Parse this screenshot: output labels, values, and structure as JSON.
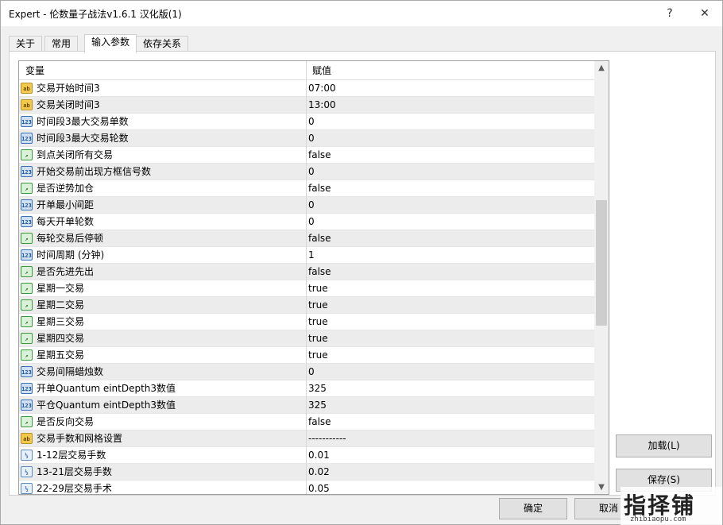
{
  "window": {
    "title": "Expert - 伦数量子战法v1.6.1 汉化版(1)",
    "help_label": "?",
    "close_label": "✕"
  },
  "tabs": [
    {
      "label": "关于",
      "active": false
    },
    {
      "label": "常用",
      "active": false
    },
    {
      "label": "输入参数",
      "active": true
    },
    {
      "label": "依存关系",
      "active": false
    }
  ],
  "grid": {
    "col_variable": "变量",
    "col_value": "赋值",
    "rows": [
      {
        "icon": "ab",
        "name": "交易开始时间3",
        "value": "07:00"
      },
      {
        "icon": "ab",
        "name": "交易关闭时间3",
        "value": "13:00"
      },
      {
        "icon": "num",
        "name": "时间段3最大交易单数",
        "value": "0"
      },
      {
        "icon": "num",
        "name": "时间段3最大交易轮数",
        "value": "0"
      },
      {
        "icon": "bool",
        "name": "到点关闭所有交易",
        "value": "false"
      },
      {
        "icon": "num",
        "name": "开始交易前出现方框信号数",
        "value": "0"
      },
      {
        "icon": "bool",
        "name": "是否逆势加仓",
        "value": "false"
      },
      {
        "icon": "num",
        "name": "开单最小间距",
        "value": "0"
      },
      {
        "icon": "num",
        "name": "每天开单轮数",
        "value": "0"
      },
      {
        "icon": "bool",
        "name": "每轮交易后停顿",
        "value": "false"
      },
      {
        "icon": "num",
        "name": "时间周期 (分钟)",
        "value": "1"
      },
      {
        "icon": "bool",
        "name": "是否先进先出",
        "value": "false"
      },
      {
        "icon": "bool",
        "name": "星期一交易",
        "value": "true"
      },
      {
        "icon": "bool",
        "name": "星期二交易",
        "value": "true"
      },
      {
        "icon": "bool",
        "name": "星期三交易",
        "value": "true"
      },
      {
        "icon": "bool",
        "name": "星期四交易",
        "value": "true"
      },
      {
        "icon": "bool",
        "name": "星期五交易",
        "value": "true"
      },
      {
        "icon": "num",
        "name": "交易间隔蜡烛数",
        "value": "0"
      },
      {
        "icon": "num",
        "name": "开单Quantum eintDepth3数值",
        "value": "325"
      },
      {
        "icon": "num",
        "name": "平仓Quantum eintDepth3数值",
        "value": "325"
      },
      {
        "icon": "bool",
        "name": "是否反向交易",
        "value": "false"
      },
      {
        "icon": "ab",
        "name": "交易手数和网格设置",
        "value": "-----------"
      },
      {
        "icon": "frac",
        "name": "1-12层交易手数",
        "value": "0.01"
      },
      {
        "icon": "frac",
        "name": "13-21层交易手数",
        "value": "0.02"
      },
      {
        "icon": "frac",
        "name": "22-29层交易手术",
        "value": "0.05"
      }
    ]
  },
  "icons": {
    "ab": "ab",
    "num": "123",
    "bool": "↗",
    "frac": "½"
  },
  "buttons": {
    "load": "加载(L)",
    "save": "保存(S)",
    "ok": "确定",
    "cancel": "取消"
  },
  "watermark": {
    "text": "指择铺",
    "url": "zhibiaopu.com"
  }
}
